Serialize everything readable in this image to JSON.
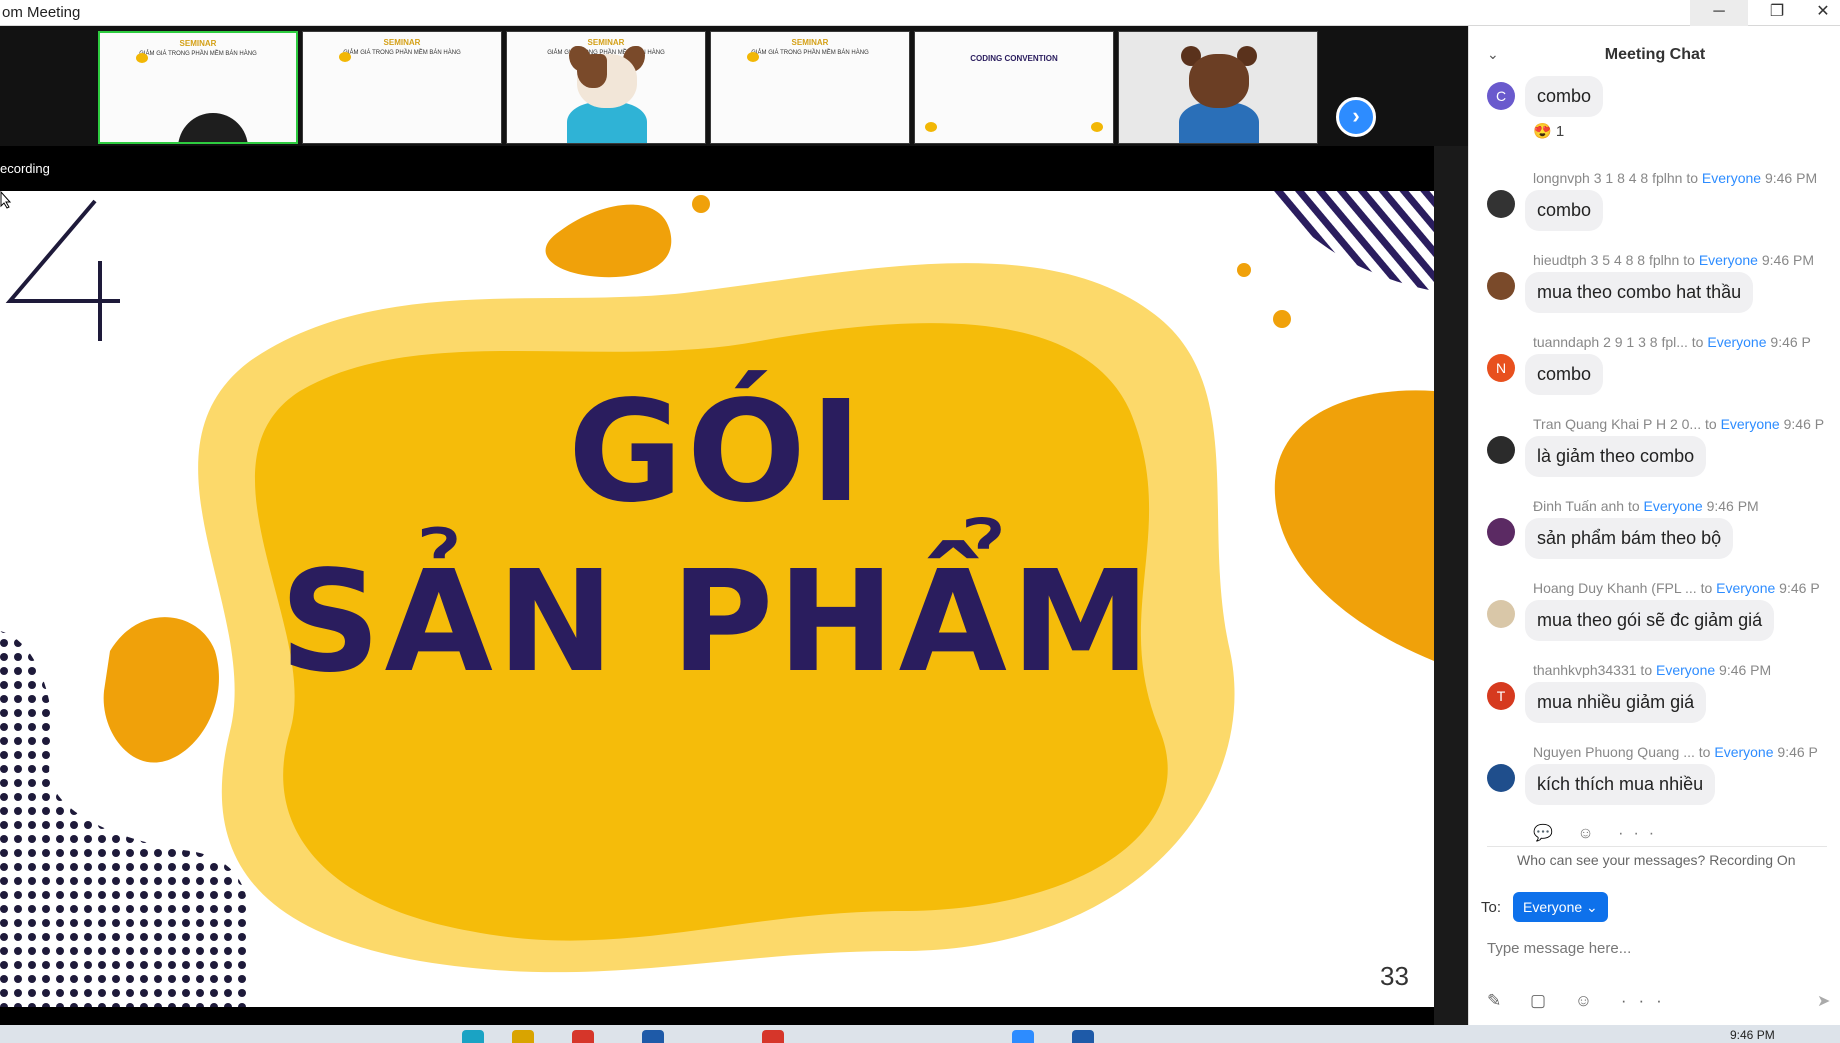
{
  "window": {
    "title": "om Meeting",
    "minimize": "─",
    "restore": "❐",
    "close": "✕"
  },
  "thumbnails": [
    {
      "title": "SEMINAR",
      "subtitle": "GIẢM GIÁ TRONG PHẦN MỀM BÁN HÀNG"
    },
    {
      "title": "SEMINAR",
      "subtitle": "GIẢM GIÁ TRONG PHẦN MỀM BÁN HÀNG"
    },
    {
      "title": "SEMINAR",
      "subtitle": "GIẢM GIÁ TRONG PHẦN MỀM BÁN HÀNG"
    },
    {
      "title": "SEMINAR",
      "subtitle": "GIẢM GIÁ TRONG PHẦN MỀM BÁN HÀNG"
    },
    {
      "title": "CODING CONVENTION",
      "subtitle": ""
    },
    {
      "title": "",
      "subtitle": ""
    }
  ],
  "share": {
    "recording_label": "ecording",
    "slide_title_line1": "GÓI",
    "slide_title_line2": "SẢN PHẨM",
    "slide_page": "33"
  },
  "colors": {
    "navy": "#2a1d5e",
    "yellow": "#f5bc0a",
    "light_yellow": "#fcd96a",
    "orange": "#f0a10a",
    "zoom_blue": "#2d8cff"
  },
  "chat": {
    "title": "Meeting Chat",
    "messages": [
      {
        "sender": "",
        "to": "",
        "time": "",
        "text": "combo",
        "avatar_letter": "C",
        "avatar_color": "#6a5acd",
        "reaction": "😍 1"
      },
      {
        "sender": "longnvph 3 1 8 4 8 fplhn to ",
        "to": "Everyone",
        "time": " 9:46 PM",
        "text": "combo",
        "avatar_letter": "",
        "avatar_color": "#333333"
      },
      {
        "sender": "hieudtph 3 5 4 8 8 fplhn to ",
        "to": "Everyone",
        "time": " 9:46 PM",
        "text": "mua theo combo hat thầu",
        "avatar_letter": "",
        "avatar_color": "#7a4a2a"
      },
      {
        "sender": "tuanndaph 2 9 1 3 8 fpl...   to ",
        "to": "Everyone",
        "time": " 9:46 P",
        "text": "combo",
        "avatar_letter": "N",
        "avatar_color": "#e8501e"
      },
      {
        "sender": "Tran Quang Khai P H 2 0...  to ",
        "to": "Everyone",
        "time": " 9:46 P",
        "text": "là giảm theo combo",
        "avatar_letter": "",
        "avatar_color": "#2b2b2b"
      },
      {
        "sender": "Đinh Tuấn anh to ",
        "to": "Everyone",
        "time": " 9:46 PM",
        "text": "sản phẩm bám theo bộ",
        "avatar_letter": "",
        "avatar_color": "#5b2a63"
      },
      {
        "sender": "Hoang Duy Khanh (FPL ...  to ",
        "to": "Everyone",
        "time": " 9:46 P",
        "text": "mua theo gói sẽ đc giảm giá",
        "avatar_letter": "",
        "avatar_color": "#d9c7a8"
      },
      {
        "sender": "thanhkvph34331 to ",
        "to": "Everyone",
        "time": " 9:46 PM",
        "text": "mua nhiều giảm giá",
        "avatar_letter": "T",
        "avatar_color": "#d63a1f"
      },
      {
        "sender": "Nguyen Phuong Quang ...  to ",
        "to": "Everyone",
        "time": " 9:46 P",
        "text": "kích thích mua nhiều",
        "avatar_letter": "",
        "avatar_color": "#1f4e8c"
      }
    ],
    "actions": "💬 ☺ ···",
    "privacy_note": "Who can see your messages? Recording On",
    "to_label": "To:",
    "to_value": "Everyone ⌄",
    "input_placeholder": "Type message here...",
    "tools": "✎ ▢ ☺ ···",
    "send": "➤",
    "collapse": "⌄"
  },
  "taskbar": {
    "time": "9:46 PM"
  }
}
